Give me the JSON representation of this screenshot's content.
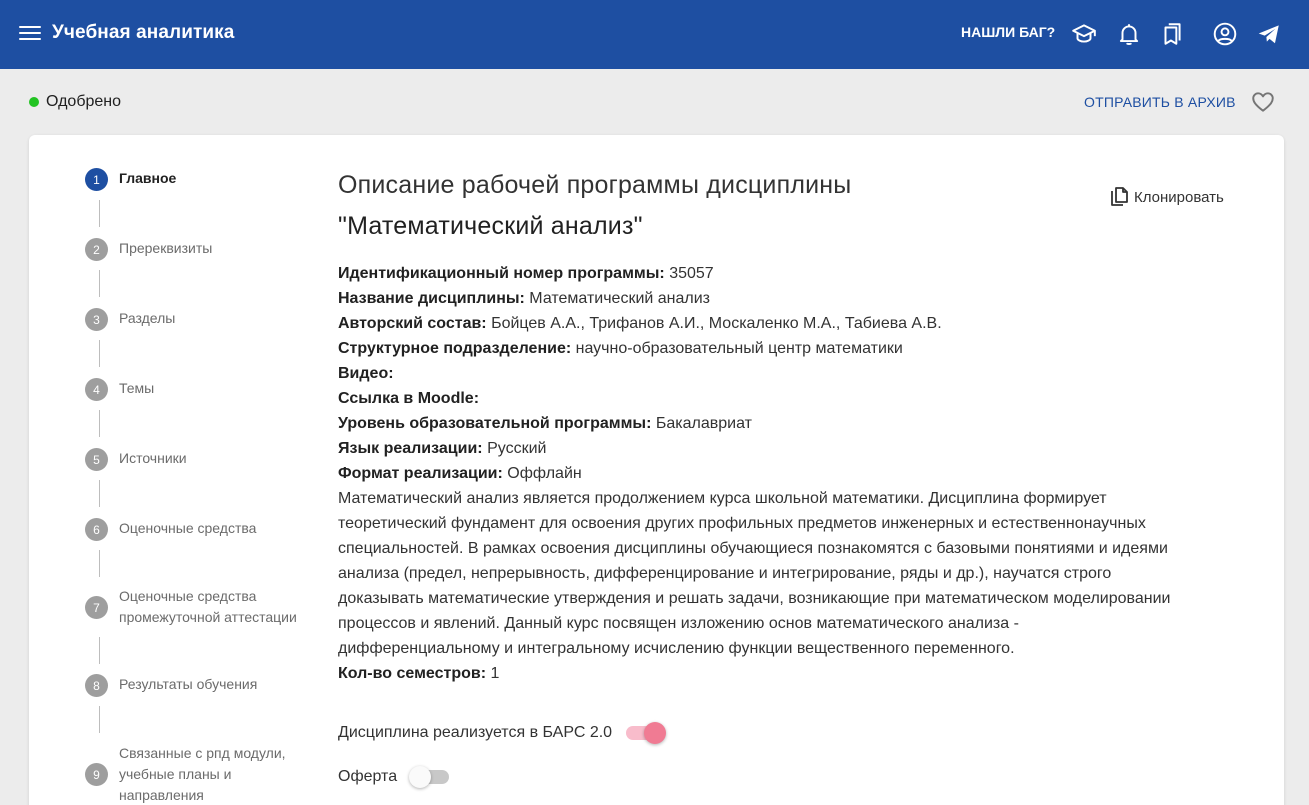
{
  "app": {
    "title": "Учебная аналитика",
    "bug_label": "НАШЛИ БАГ?"
  },
  "status": {
    "text": "Одобрено",
    "archive_label": "ОТПРАВИТЬ В АРХИВ",
    "dot_color": "#22c322"
  },
  "steps": [
    {
      "num": "1",
      "label": "Главное"
    },
    {
      "num": "2",
      "label": "Пререквизиты"
    },
    {
      "num": "3",
      "label": "Разделы"
    },
    {
      "num": "4",
      "label": "Темы"
    },
    {
      "num": "5",
      "label": "Источники"
    },
    {
      "num": "6",
      "label": "Оценочные средства"
    },
    {
      "num": "7",
      "label": "Оценочные средства промежуточной аттестации"
    },
    {
      "num": "8",
      "label": "Результаты обучения"
    },
    {
      "num": "9",
      "label": "Связанные с рпд модули, учебные планы и направления"
    }
  ],
  "main": {
    "title_line1": "Описание рабочей программы дисциплины",
    "title_line2": "\"Математический анализ\"",
    "clone_label": "Клонировать",
    "fields": {
      "id_label": "Идентификационный номер программы:",
      "id_value": " 35057",
      "name_label": "Название дисциплины:",
      "name_value": " Математический анализ",
      "authors_label": "Авторский состав:",
      "authors_value": " Бойцев А.А., Трифанов А.И., Москаленко М.А., Табиева А.В.",
      "division_label": "Структурное подразделение:",
      "division_value": " научно-образовательный центр математики",
      "video_label": "Видео:",
      "moodle_label": "Ссылка в Moodle:",
      "level_label": "Уровень образовательной программы:",
      "level_value": " Бакалавриат",
      "lang_label": "Язык реализации:",
      "lang_value": " Русский",
      "format_label": "Формат реализации:",
      "format_value": " Оффлайн",
      "description": "Математический анализ является продолжением курса школьной математики. Дисциплина формирует теоретический фундамент для освоения других профильных предметов инженерных и естественнонаучных специальностей. В рамках освоения дисциплины обучающиеся познакомятся с базовыми понятиями и идеями анализа (предел, непрерывность, дифференцирование и интегрирование, ряды и др.), научатся строго доказывать математические утверждения и решать задачи, возникающие при математическом моделировании процессов и явлений. Данный курс посвящен изложению основ математического анализа - дифференциальному и интегральному исчислению функции вещественного переменного.",
      "semesters_label": "Кол-во семестров:",
      "semesters_value": " 1"
    },
    "toggles": {
      "bars_label": "Дисциплина реализуется в БАРС 2.0",
      "bars_on": true,
      "offer_label": "Оферта",
      "offer_on": false
    }
  },
  "colors": {
    "appbar": "#1e4fa2",
    "accent": "#1e4fa2",
    "toggle_on": "#f07b93"
  }
}
